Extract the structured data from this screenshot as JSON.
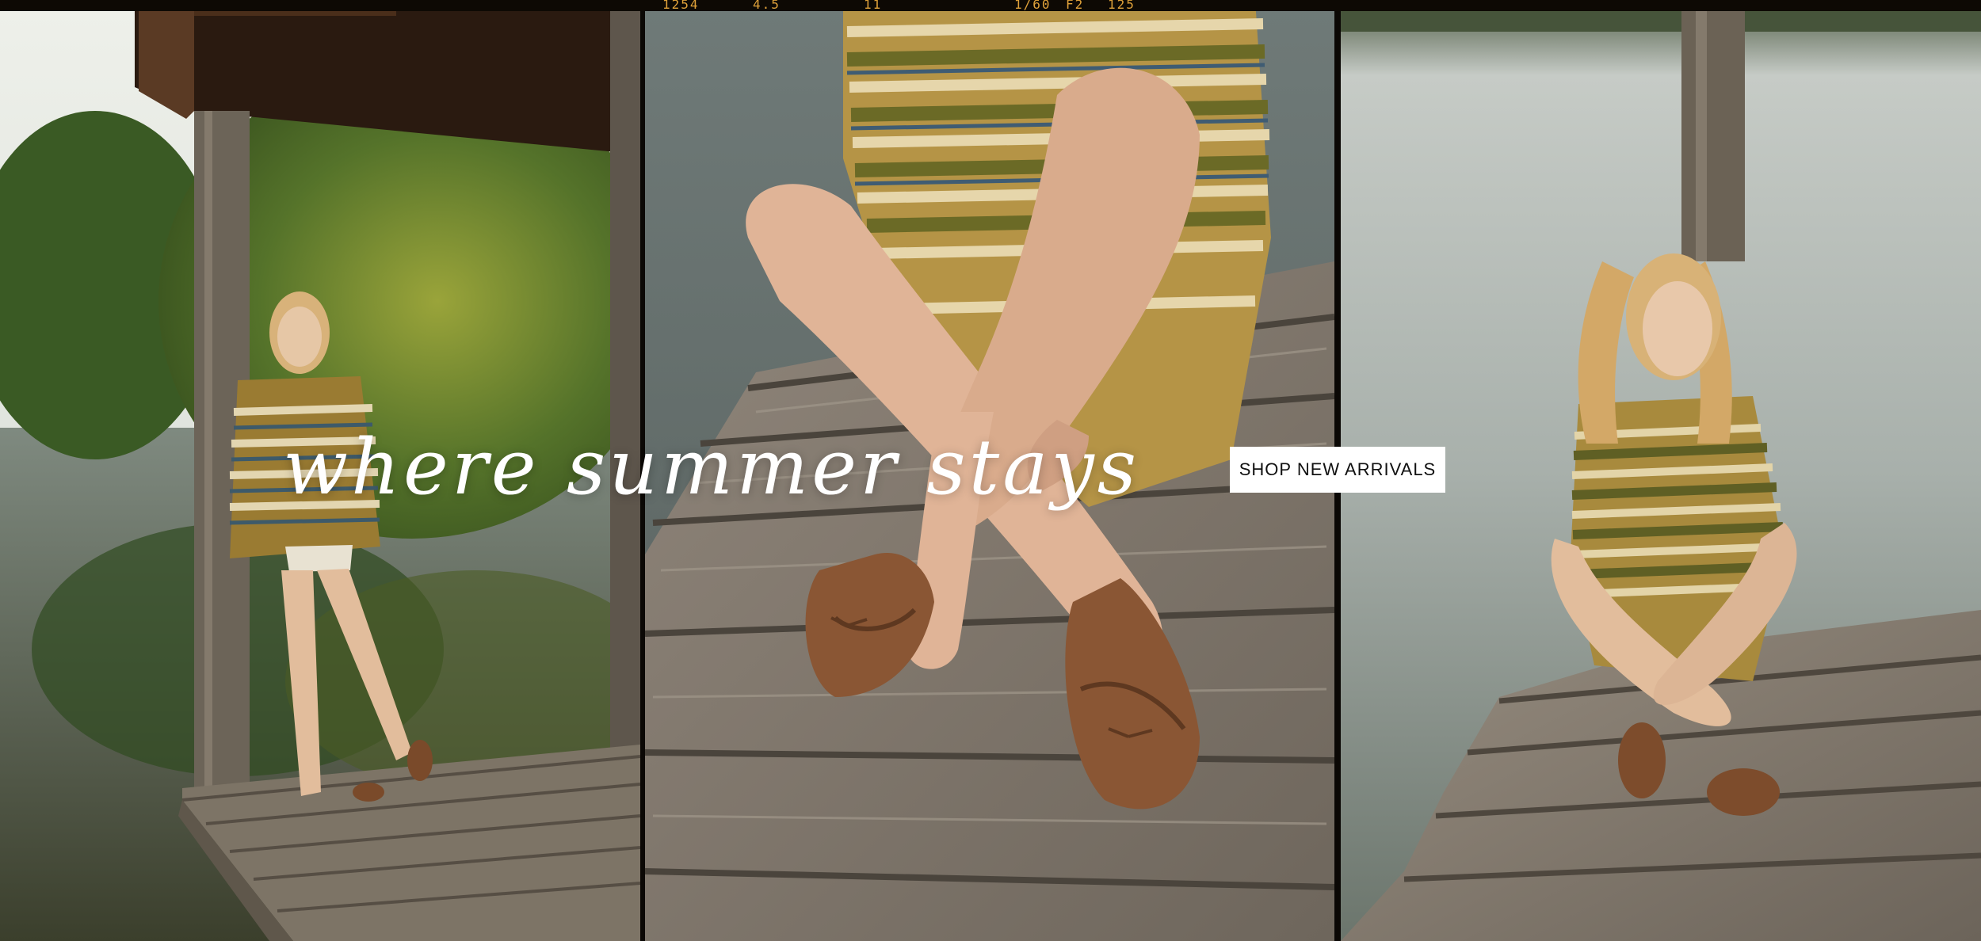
{
  "hero": {
    "headline": "where summer stays",
    "cta_label": "SHOP NEW ARRIVALS"
  },
  "film_strip": {
    "codes": [
      "1254",
      "4.5",
      "11",
      "1/60",
      "F2",
      "125"
    ]
  },
  "colors": {
    "headline_text": "#ffffff",
    "cta_background": "#ffffff",
    "cta_text": "#111111",
    "film_border": "#0d0904",
    "film_code": "#e0a23a"
  },
  "images": [
    {
      "name": "left-photo",
      "subject": "model standing on boathouse dock by lake"
    },
    {
      "name": "middle-photo",
      "subject": "close-up of crossed legs in suede ballet flats on dock"
    },
    {
      "name": "right-photo",
      "subject": "model seated cross-legged on dock over lake"
    }
  ]
}
